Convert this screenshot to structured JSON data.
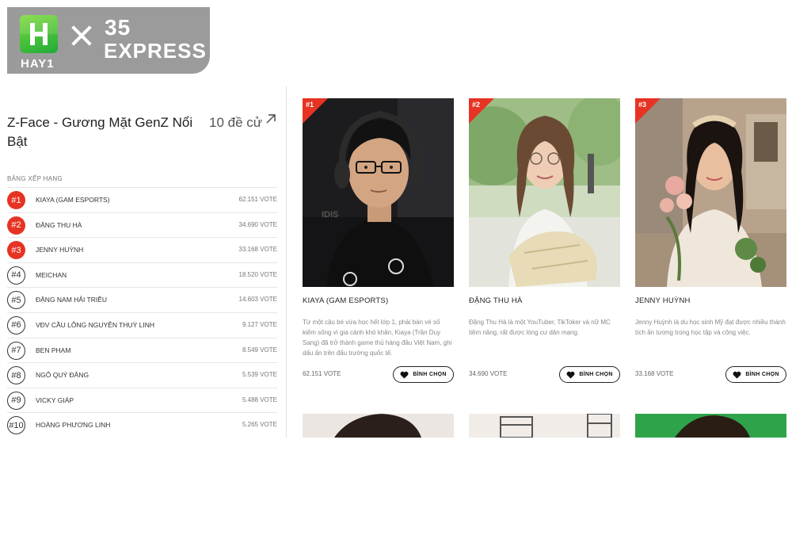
{
  "brand": {
    "logo_text": "HAY1",
    "number": "35",
    "word": "EXPRESS"
  },
  "section": {
    "title": "Z-Face - Gương Mặt GenZ Nổi Bật",
    "more_label": "10 đề cử",
    "ranking_heading": "BẢNG XẾP HẠNG"
  },
  "ranking": [
    {
      "rank": "#1",
      "name": "KIAYA (GAM ESPORTS)",
      "votes": "62.151 VOTE",
      "highlight": true
    },
    {
      "rank": "#2",
      "name": "ĐẶNG THU HÀ",
      "votes": "34.690 VOTE",
      "highlight": true
    },
    {
      "rank": "#3",
      "name": "JENNY HUỲNH",
      "votes": "33.168 VOTE",
      "highlight": true
    },
    {
      "rank": "#4",
      "name": "MEICHAN",
      "votes": "18.520 VOTE",
      "highlight": false
    },
    {
      "rank": "#5",
      "name": "ĐẶNG NAM HẢI TRIỀU",
      "votes": "14.603 VOTE",
      "highlight": false
    },
    {
      "rank": "#6",
      "name": "VĐV CẦU LÔNG NGUYỄN THUỲ LINH",
      "votes": "9.127 VOTE",
      "highlight": false
    },
    {
      "rank": "#7",
      "name": "BEN PHẠM",
      "votes": "8.549 VOTE",
      "highlight": false
    },
    {
      "rank": "#8",
      "name": "NGÔ QUÝ ĐĂNG",
      "votes": "5.539 VOTE",
      "highlight": false
    },
    {
      "rank": "#9",
      "name": "VICKY GIÁP",
      "votes": "5.488 VOTE",
      "highlight": false
    },
    {
      "rank": "#10",
      "name": "HOÀNG PHƯƠNG LINH",
      "votes": "5.265 VOTE",
      "highlight": false
    }
  ],
  "cards": [
    {
      "rank": "#1",
      "name": "KIAYA (GAM ESPORTS)",
      "description": "Từ một cậu bé vừa học hết lớp 1, phải bán vé số kiếm sống vì gia cảnh khó khăn, Kiaya (Trần Duy Sang) đã trở thành game thủ hàng đầu Việt Nam, ghi dấu ấn trên đấu trường quốc tế.",
      "votes": "62.151 VOTE",
      "button": "BÌNH CHỌN"
    },
    {
      "rank": "#2",
      "name": "ĐẶNG THU HÀ",
      "description": "Đặng Thu Hà là một YouTuber, TikToker và nữ MC tiềm năng, rất được lòng cư dân mạng.",
      "votes": "34.690 VOTE",
      "button": "BÌNH CHỌN"
    },
    {
      "rank": "#3",
      "name": "JENNY HUỲNH",
      "description": "Jenny Huỳnh là du học sinh Mỹ đạt được nhiều thành tích ấn tượng trong học tập và công việc.",
      "votes": "33.168 VOTE",
      "button": "BÌNH CHỌN"
    }
  ],
  "colors": {
    "accent": "#e63323",
    "banner": "#9b9b9b",
    "logo_green": "#1faa3a"
  }
}
